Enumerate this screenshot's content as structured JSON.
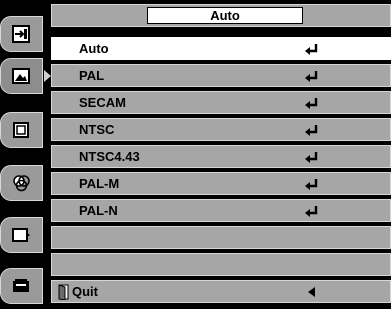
{
  "sidebar": {
    "tabs": [
      {
        "icon": "input-icon"
      },
      {
        "icon": "picture-adjust-icon"
      },
      {
        "icon": "screen-icon"
      },
      {
        "icon": "color-icon"
      },
      {
        "icon": "setting-icon"
      },
      {
        "icon": "information-icon"
      }
    ]
  },
  "menu": {
    "title": "Auto",
    "items": [
      {
        "label": "Auto"
      },
      {
        "label": "PAL"
      },
      {
        "label": "SECAM"
      },
      {
        "label": "NTSC"
      },
      {
        "label": "NTSC4.43"
      },
      {
        "label": "PAL-M"
      },
      {
        "label": "PAL-N"
      }
    ],
    "quit_label": "Quit"
  }
}
